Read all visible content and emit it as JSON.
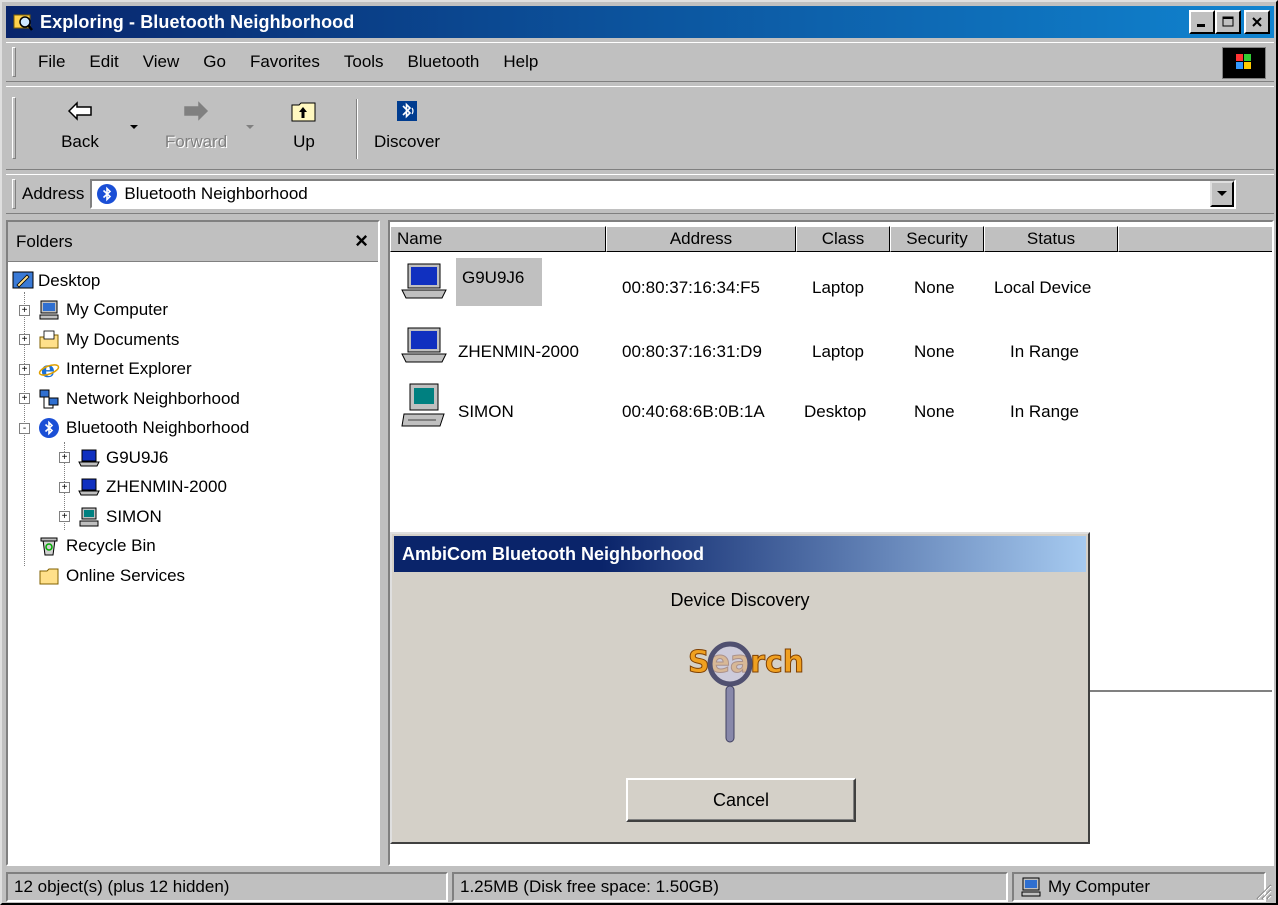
{
  "window": {
    "title": "Exploring - Bluetooth Neighborhood",
    "title_colors": {
      "start": "#08246b",
      "end": "#1084d0"
    }
  },
  "menubar": {
    "items": [
      "File",
      "Edit",
      "View",
      "Go",
      "Favorites",
      "Tools",
      "Bluetooth",
      "Help"
    ]
  },
  "toolbar": {
    "back": "Back",
    "forward": "Forward",
    "up": "Up",
    "discover": "Discover"
  },
  "address": {
    "label": "Address",
    "value": "Bluetooth Neighborhood"
  },
  "folders": {
    "header": "Folders",
    "close": "×",
    "tree": [
      {
        "label": "Desktop",
        "icon": "desktop-icon",
        "level": 0
      },
      {
        "label": "My Computer",
        "icon": "my-computer-icon",
        "level": 1,
        "expander": "+"
      },
      {
        "label": "My Documents",
        "icon": "my-documents-icon",
        "level": 1,
        "expander": "+"
      },
      {
        "label": "Internet Explorer",
        "icon": "internet-explorer-icon",
        "level": 1,
        "expander": "+"
      },
      {
        "label": "Network Neighborhood",
        "icon": "network-icon",
        "level": 1,
        "expander": "+"
      },
      {
        "label": "Bluetooth Neighborhood",
        "icon": "bluetooth-icon",
        "level": 1,
        "expander": "-"
      },
      {
        "label": "G9U9J6",
        "icon": "laptop-icon",
        "level": 2,
        "expander": "+"
      },
      {
        "label": "ZHENMIN-2000",
        "icon": "laptop-icon",
        "level": 2,
        "expander": "+"
      },
      {
        "label": "SIMON",
        "icon": "desktop-computer-icon",
        "level": 2,
        "expander": "+"
      },
      {
        "label": "Recycle Bin",
        "icon": "recycle-bin-icon",
        "level": 1
      },
      {
        "label": "Online Services",
        "icon": "folder-icon",
        "level": 1
      }
    ]
  },
  "list": {
    "columns": [
      "Name",
      "Address",
      "Class",
      "Security",
      "Status"
    ],
    "rows": [
      {
        "name": "G9U9J6",
        "address": "00:80:37:16:34:F5",
        "class": "Laptop",
        "security": "None",
        "status": "Local Device",
        "icon": "laptop-icon"
      },
      {
        "name": "ZHENMIN-2000",
        "address": "00:80:37:16:31:D9",
        "class": "Laptop",
        "security": "None",
        "status": "In Range",
        "icon": "laptop-icon"
      },
      {
        "name": "SIMON",
        "address": "00:40:68:6B:0B:1A",
        "class": "Desktop",
        "security": "None",
        "status": "In Range",
        "icon": "desktop-computer-icon"
      }
    ]
  },
  "statusbar": {
    "objects": "12 object(s) (plus 12 hidden)",
    "disk": "1.25MB (Disk free space: 1.50GB)",
    "zone": "My Computer"
  },
  "dialog": {
    "title": "AmbiCom Bluetooth Neighborhood",
    "message": "Device Discovery",
    "cancel": "Cancel",
    "graphic_text": "Search",
    "title_colors": {
      "start": "#0a246a",
      "end": "#a6caf0"
    }
  }
}
